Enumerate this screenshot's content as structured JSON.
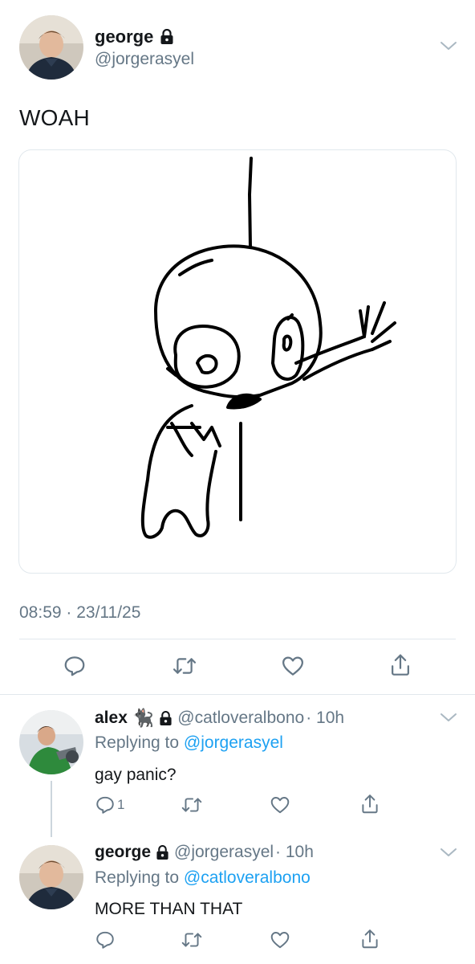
{
  "main_tweet": {
    "name": "george",
    "handle": "@jorgerasyel",
    "text": "WOAH",
    "timestamp": "08:59 · 23/11/25"
  },
  "replies": [
    {
      "name": "alex",
      "name_emoji": "🐈‍⬛",
      "handle": "@catloveralbono",
      "time": "· 10h",
      "replying_prefix": "Replying to",
      "replying_to": "@jorgerasyel",
      "text": "gay panic?",
      "reply_count": "1"
    },
    {
      "name": "george",
      "handle": "@jorgerasyel",
      "time": "· 10h",
      "replying_prefix": "Replying to",
      "replying_to": "@catloveralbono",
      "text": "MORE THAN THAT",
      "reply_count": ""
    }
  ],
  "icons": {
    "lock": "lock-icon",
    "more": "chevron-down-icon",
    "reply": "reply-icon",
    "retweet": "retweet-icon",
    "like": "heart-icon",
    "share": "share-icon"
  },
  "colors": {
    "text": "#14171a",
    "secondary": "#657786",
    "link": "#1da1f2",
    "border": "#e1e8ed"
  }
}
